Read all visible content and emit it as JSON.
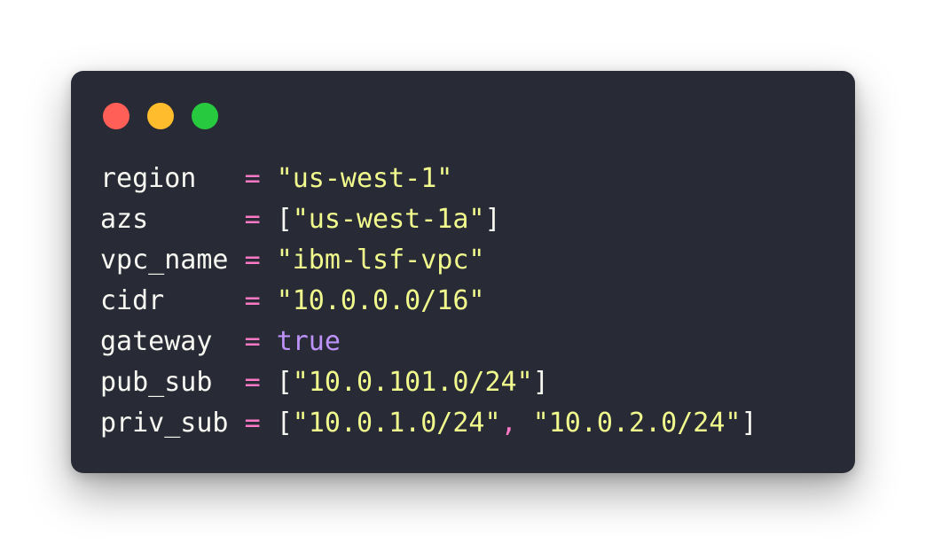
{
  "window": {
    "background": "#282a36",
    "traffic_lights": [
      {
        "name": "close",
        "color": "#ff5f56"
      },
      {
        "name": "minimize",
        "color": "#ffbd2e"
      },
      {
        "name": "maximize",
        "color": "#27c93f"
      }
    ]
  },
  "syntax_colors": {
    "text": "#f8f8f2",
    "operator": "#ff79c6",
    "string": "#f1fa8c",
    "boolean": "#bd93f9"
  },
  "code": {
    "lines": [
      {
        "key": "region  ",
        "op": "=",
        "value": "\"us-west-1\""
      },
      {
        "key": "azs     ",
        "op": "=",
        "open": "[",
        "value": "\"us-west-1a\"",
        "close": "]"
      },
      {
        "key": "vpc_name",
        "op": "=",
        "value": "\"ibm-lsf-vpc\""
      },
      {
        "key": "cidr    ",
        "op": "=",
        "value": "\"10.0.0.0/16\""
      },
      {
        "key": "gateway ",
        "op": "=",
        "value": "true"
      },
      {
        "key": "pub_sub ",
        "op": "=",
        "open": "[",
        "value": "\"10.0.101.0/24\"",
        "close": "]"
      },
      {
        "key": "priv_sub",
        "op": "=",
        "open": "[",
        "value": "\"10.0.1.0/24\"",
        "sep": ",",
        "value2": "\"10.0.2.0/24\"",
        "close": "]"
      }
    ]
  }
}
